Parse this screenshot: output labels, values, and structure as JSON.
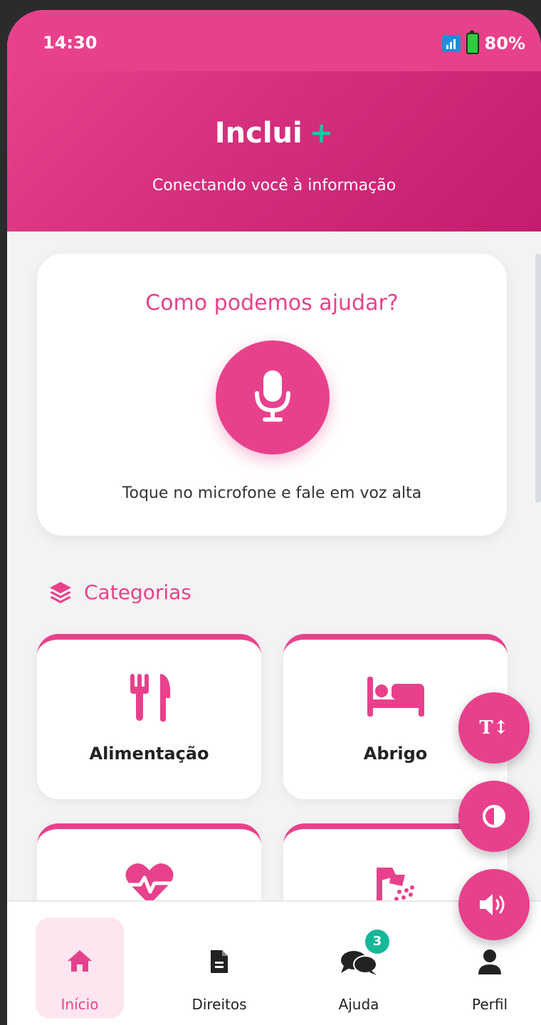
{
  "status": {
    "time": "14:30",
    "battery": "80%"
  },
  "header": {
    "title": "Inclui",
    "plus": "+",
    "tagline": "Conectando você à informação"
  },
  "help": {
    "title": "Como podemos ajudar?",
    "hint": "Toque no microfone e fale em voz alta"
  },
  "categories": {
    "heading": "Categorias",
    "items": [
      {
        "label": "Alimentação",
        "icon": "utensils-icon"
      },
      {
        "label": "Abrigo",
        "icon": "bed-icon"
      },
      {
        "label": "",
        "icon": "heartbeat-icon"
      },
      {
        "label": "",
        "icon": "shower-icon"
      }
    ]
  },
  "fabs": [
    {
      "icon": "text-size-icon",
      "text": "T↕"
    },
    {
      "icon": "contrast-icon"
    },
    {
      "icon": "volume-icon"
    }
  ],
  "nav": {
    "items": [
      {
        "label": "Início",
        "icon": "home-icon",
        "active": true
      },
      {
        "label": "Direitos",
        "icon": "document-icon"
      },
      {
        "label": "Ajuda",
        "icon": "comments-icon",
        "badge": "3"
      },
      {
        "label": "Perfil",
        "icon": "user-icon"
      }
    ]
  },
  "colors": {
    "primary": "#e8418b",
    "accent": "#22c3a6",
    "badge": "#16b89a",
    "background": "#f3f3f3"
  }
}
